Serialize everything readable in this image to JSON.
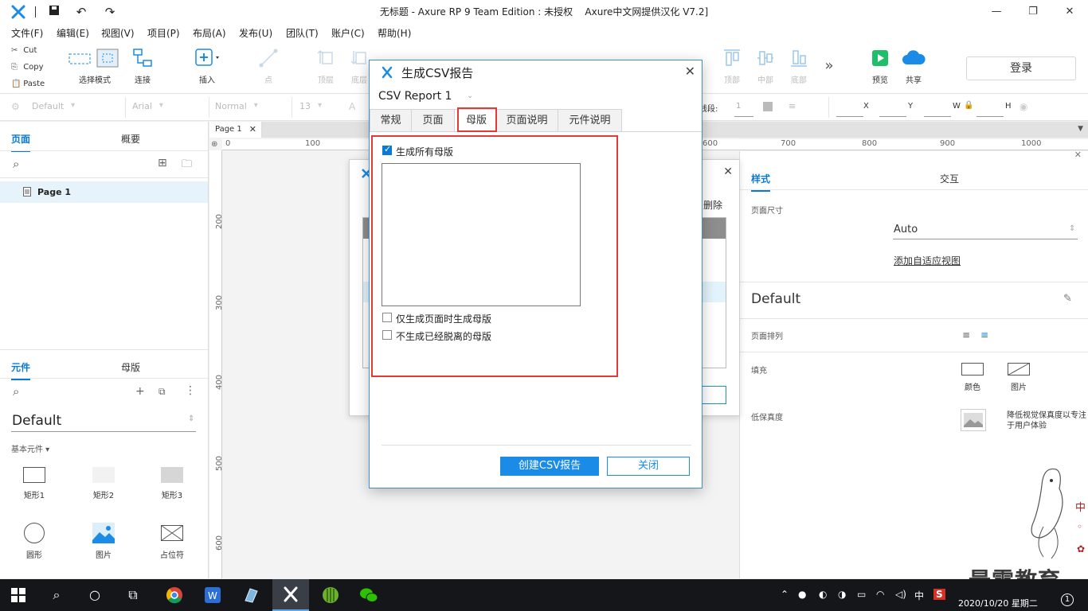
{
  "window": {
    "title": "无标题 - Axure RP 9 Team Edition : 未授权",
    "title_suffix": "Axure中文网提供汉化 V7.2]"
  },
  "menu": [
    "文件(F)",
    "编辑(E)",
    "视图(V)",
    "项目(P)",
    "布局(A)",
    "发布(U)",
    "团队(T)",
    "账户(C)",
    "帮助(H)"
  ],
  "clipboard": {
    "cut": "Cut",
    "copy": "Copy",
    "paste": "Paste"
  },
  "toolbar": {
    "select_mode": "选择模式",
    "connect": "连接",
    "insert": "插入",
    "point": "点",
    "top_layer": "顶层",
    "bottom_layer": "底层",
    "align_top": "顶部",
    "align_middle": "中部",
    "align_bottom": "底部",
    "preview": "预览",
    "share": "共享",
    "login": "登录"
  },
  "formatbar": {
    "style": "Default",
    "font": "Arial",
    "weight": "Normal",
    "size": "13",
    "line_label": "线段:",
    "line_value": "1",
    "x_label": "X",
    "y_label": "Y",
    "w_label": "W",
    "h_label": "H"
  },
  "left_panel": {
    "tab_pages": "页面",
    "tab_outline": "概要",
    "page_name": "Page 1",
    "tab_widgets": "元件",
    "tab_masters": "母版",
    "library": "Default",
    "section": "基本元件 ▾",
    "widgets": [
      "矩形1",
      "矩形2",
      "矩形3",
      "圆形",
      "图片",
      "占位符"
    ]
  },
  "canvas": {
    "tab": "Page 1",
    "ruler_h": [
      "0",
      "100",
      "600",
      "700",
      "800",
      "900",
      "1000"
    ],
    "ruler_v": [
      "200",
      "300",
      "400",
      "500",
      "600"
    ]
  },
  "right_panel": {
    "tab_style": "样式",
    "tab_interact": "交互",
    "page_size_label": "页面尺寸",
    "page_size_value": "Auto",
    "adaptive_link": "添加自适应视图",
    "style_name": "Default",
    "page_align_label": "页面排列",
    "fill_label": "填充",
    "fill_color": "颜色",
    "fill_image": "图片",
    "low_fidelity_label": "低保真度",
    "low_fidelity_desc": "降低视觉保真度以专注于用户体验"
  },
  "bg_dialog": {
    "delete_label": "删除"
  },
  "dialog": {
    "title": "生成CSV报告",
    "report_name": "CSV Report 1",
    "tabs": [
      "常规",
      "页面",
      "母版",
      "页面说明",
      "元件说明"
    ],
    "active_tab": "母版",
    "generate_all_masters": "生成所有母版",
    "only_generate_with_pages": "仅生成页面时生成母版",
    "skip_detached_masters": "不生成已经脱离的母版",
    "create_button": "创建CSV报告",
    "close_button": "关闭"
  },
  "watermark": "最需教育",
  "taskbar": {
    "ime": "中",
    "date": "2020/10/20 星期二",
    "notification_count": "1"
  },
  "colors": {
    "accent": "#0a7ad6",
    "highlight_red": "#e53935",
    "taskbar": "#14161a"
  }
}
